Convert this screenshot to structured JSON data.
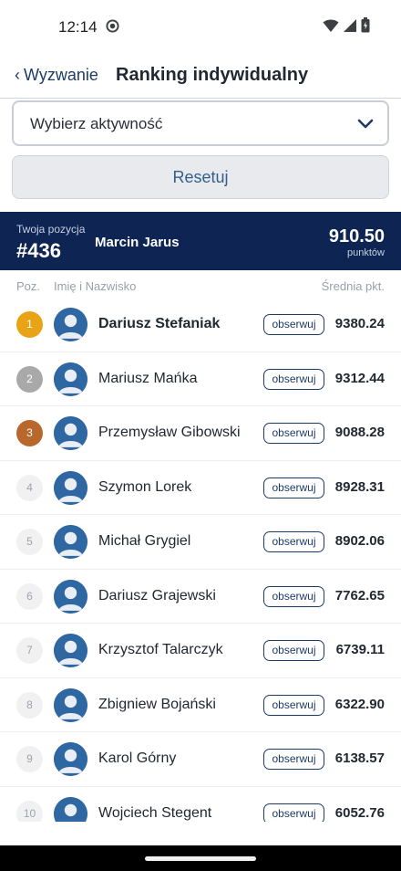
{
  "status_bar": {
    "time": "12:14",
    "icons": [
      "wifi-icon",
      "signal-icon",
      "battery-icon"
    ]
  },
  "header": {
    "back_label": "Wyzwanie",
    "title": "Ranking indywidualny"
  },
  "filter": {
    "placeholder": "Wybierz aktywność",
    "reset_label": "Resetuj"
  },
  "my_position": {
    "label": "Twoja pozycja",
    "rank": "#436",
    "name": "Marcin Jarus",
    "score": "910.50",
    "unit": "punktów"
  },
  "columns": {
    "position": "Poz.",
    "name": "Imię i Nazwisko",
    "average": "Średnia pkt."
  },
  "follow_label": "obserwuj",
  "ranking": [
    {
      "pos": "1",
      "name": "Dariusz Stefaniak",
      "score": "9380.24"
    },
    {
      "pos": "2",
      "name": "Mariusz Mańka",
      "score": "9312.44"
    },
    {
      "pos": "3",
      "name": "Przemysław Gibowski",
      "score": "9088.28"
    },
    {
      "pos": "4",
      "name": "Szymon Lorek",
      "score": "8928.31"
    },
    {
      "pos": "5",
      "name": "Michał Grygiel",
      "score": "8902.06"
    },
    {
      "pos": "6",
      "name": "Dariusz Grajewski",
      "score": "7762.65"
    },
    {
      "pos": "7",
      "name": "Krzysztof Talarczyk",
      "score": "6739.11"
    },
    {
      "pos": "8",
      "name": "Zbigniew Bojański",
      "score": "6322.90"
    },
    {
      "pos": "9",
      "name": "Karol Górny",
      "score": "6138.57"
    },
    {
      "pos": "10",
      "name": "Wojciech Stegent",
      "score": "6052.76"
    }
  ],
  "colors": {
    "brand_dark": "#0e2452",
    "accent": "#1e3a66",
    "gold": "#e8a317",
    "silver": "#a9a9a9",
    "bronze": "#b8682c"
  }
}
